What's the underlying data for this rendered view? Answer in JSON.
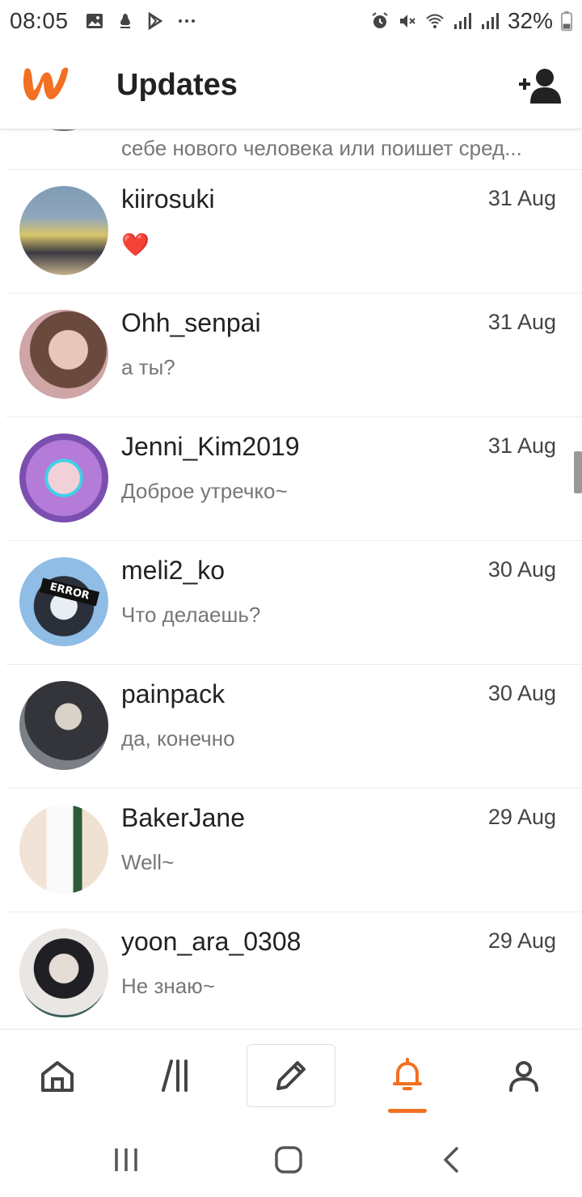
{
  "status_bar": {
    "time": "08:05",
    "battery": "32%",
    "icons": [
      "gallery-icon",
      "notification-icon",
      "play-store-icon",
      "more-dots-icon",
      "alarm-icon",
      "mute-icon",
      "wifi-icon",
      "signal-icon",
      "signal-icon",
      "battery-icon"
    ]
  },
  "header": {
    "title": "Updates",
    "logo": "wattpad-logo",
    "action_icon": "add-friend-icon"
  },
  "colors": {
    "accent": "#f36f21",
    "divider": "#ececec"
  },
  "partial_message": {
    "preview": "себе нового человека или поишет сред..."
  },
  "messages": [
    {
      "name": "kiirosuki",
      "date": "31 Aug",
      "preview": "❤️",
      "is_emoji": true
    },
    {
      "name": "Ohh_senpai",
      "date": "31 Aug",
      "preview": "а ты?"
    },
    {
      "name": "Jenni_Kim2019",
      "date": "31 Aug",
      "preview": "Доброе утречко~"
    },
    {
      "name": "meli2_ko",
      "date": "30 Aug",
      "preview": "Что делаешь?"
    },
    {
      "name": "painpack",
      "date": "30 Aug",
      "preview": "да, конечно"
    },
    {
      "name": "BakerJane",
      "date": "29 Aug",
      "preview": "Well~"
    },
    {
      "name": "yoon_ara_0308",
      "date": "29 Aug",
      "preview": "Не знаю~"
    }
  ],
  "avatar_badges": {
    "meli2_ko": "ERROR"
  },
  "bottom_nav": {
    "items": [
      "home-icon",
      "library-icon",
      "write-icon",
      "notifications-icon",
      "profile-icon"
    ],
    "active": "notifications-icon"
  },
  "system_nav": [
    "recents-icon",
    "home-button-icon",
    "back-icon"
  ]
}
